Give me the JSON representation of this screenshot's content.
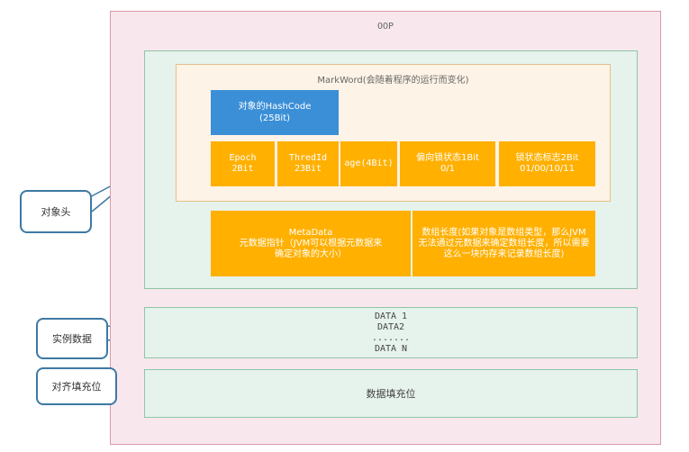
{
  "oop": {
    "title": "OOP"
  },
  "header": {
    "markword": {
      "title": "MarkWord(会随着程序的运行而变化)",
      "hashcode": {
        "line1": "对象的HashCode",
        "line2": "(25Bit)"
      },
      "fields": [
        {
          "line1": "Epoch",
          "line2": "2Bit"
        },
        {
          "line1": "ThredId",
          "line2": "23Bit"
        },
        {
          "line1": "age(4Bit)",
          "line2": ""
        },
        {
          "line1": "偏向锁状态1Bit",
          "line2": "0/1"
        },
        {
          "line1": "锁状态标志2Bit",
          "line2": "01/00/10/11"
        }
      ]
    },
    "metadata": {
      "line1": "MetaData",
      "line2": "元数据指针（JVM可以根据元数据来",
      "line3": "确定对象的大小）"
    },
    "array_length": {
      "text": "数组长度(如果对象是数组类型，那么JVM无法通过元数据来确定数组长度，所以需要这么一块内存来记录数组长度)"
    }
  },
  "instance_data": {
    "lines": [
      "DATA 1",
      "DATA2",
      ".......",
      "DATA N"
    ]
  },
  "padding": {
    "text": "数据填充位"
  },
  "labels": {
    "header": "对象头",
    "instance": "实例数据",
    "align": "对齐填充位"
  },
  "colors": {
    "oop_bg": "#f8e8ee",
    "section_bg": "#e6f2ec",
    "markword_bg": "#fdf3e6",
    "blue": "#3b8fd7",
    "orange": "#ffb000",
    "callout": "#3d79a3"
  }
}
